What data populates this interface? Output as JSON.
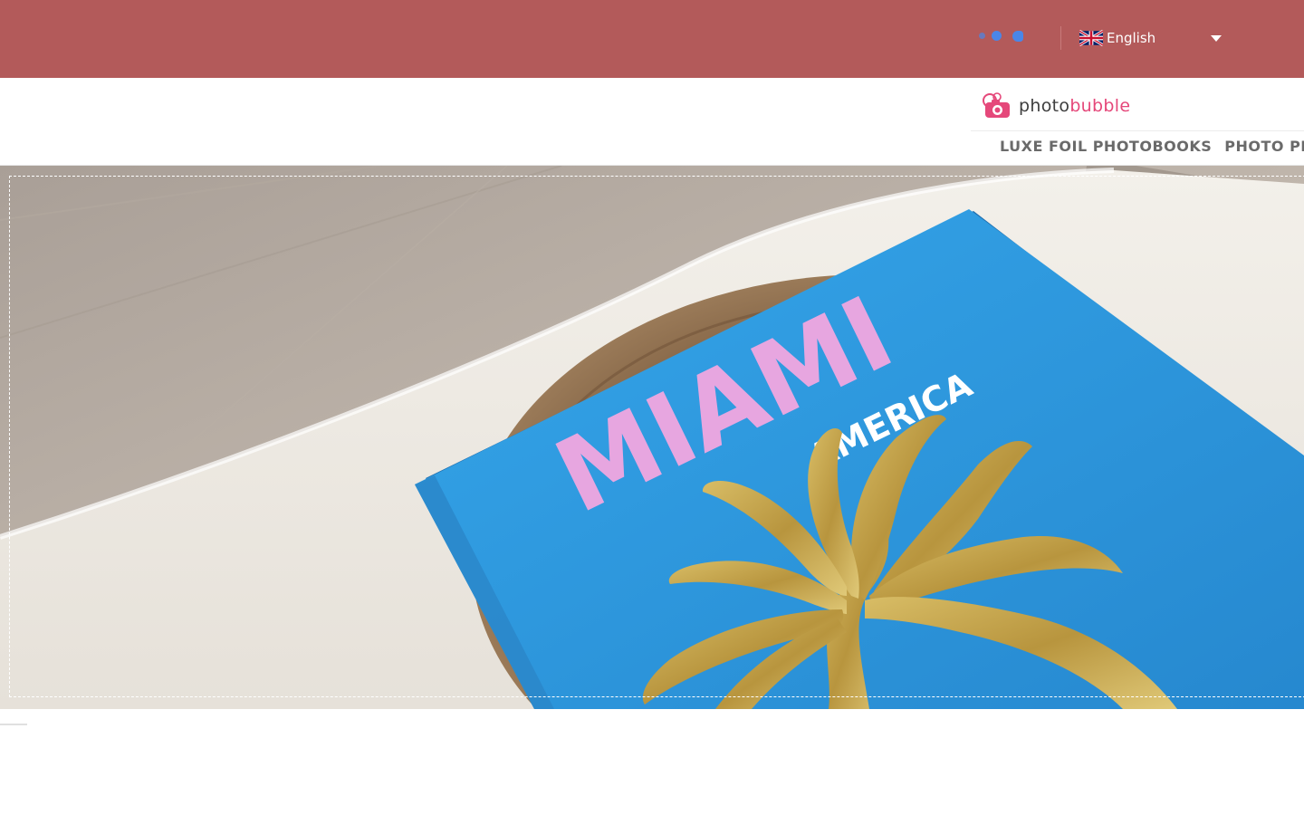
{
  "topbar": {
    "background": "#b35a5a",
    "indicator_icon": "loading-dots-icon",
    "language": {
      "flag_icon": "uk-flag-icon",
      "selected": "English",
      "caret_icon": "caret-down-icon"
    }
  },
  "header": {
    "logo": {
      "icon": "camera-bubble-icon",
      "text_part1": "photo",
      "text_part2": "bubble",
      "brand_color": "#e5487a"
    },
    "nav": {
      "items": [
        {
          "label": "LUXE FOIL PHOTOBOOKS"
        },
        {
          "label": "PHOTO PR"
        }
      ]
    }
  },
  "hero": {
    "book_title": "MIAMI",
    "book_subtitle": "AMERICA",
    "cover_color": "#2f9be0",
    "title_color": "#e7a6e0",
    "foil_color": "#c9a84a"
  }
}
